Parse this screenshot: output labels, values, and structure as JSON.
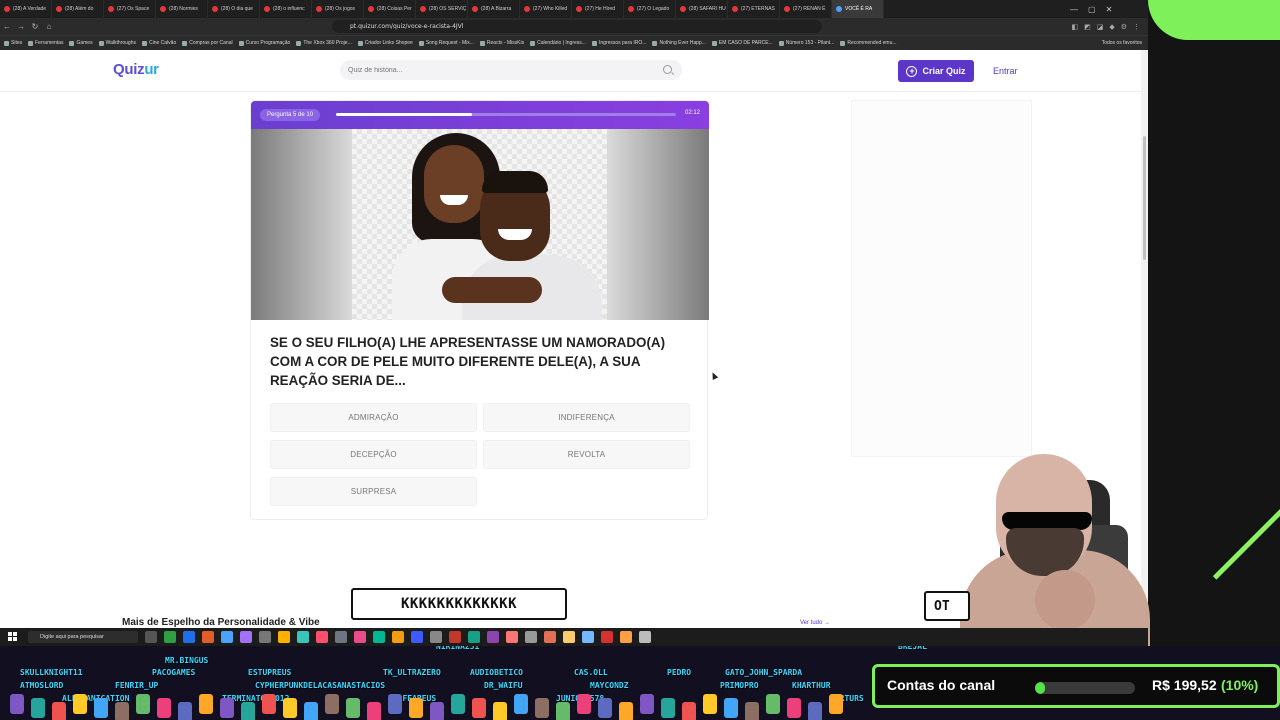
{
  "browser": {
    "tabs": [
      {
        "title": "(28) A Verdade",
        "active": false
      },
      {
        "title": "(28) Além do",
        "active": false
      },
      {
        "title": "(27) Os Space",
        "active": false
      },
      {
        "title": "(28) Normies",
        "active": false
      },
      {
        "title": "(28) O dia que",
        "active": false
      },
      {
        "title": "(28) o influenc",
        "active": false
      },
      {
        "title": "(28) Os jogos",
        "active": false
      },
      {
        "title": "(28) Coisas Per",
        "active": false
      },
      {
        "title": "(28) OS SERVIÇ",
        "active": false
      },
      {
        "title": "(28) A Bizarra",
        "active": false
      },
      {
        "title": "(27) Who Killed",
        "active": false
      },
      {
        "title": "(27) He Hired",
        "active": false
      },
      {
        "title": "(27) O Legado",
        "active": false
      },
      {
        "title": "(28) SAFARI HU",
        "active": false
      },
      {
        "title": "(27) ETERNAS",
        "active": false
      },
      {
        "title": "(27) RENAN É",
        "active": false
      },
      {
        "title": "VOCÊ É RA",
        "active": true
      }
    ],
    "url": "pt.quizur.com/quiz/voce-e-racista-4JVl",
    "bookmarks": [
      "Sites",
      "Ferramentas",
      "Games",
      "Walkthroughs",
      "Cine Calvão",
      "Compras por Canal",
      "Curso Programação",
      "The Xbox 360 Proje...",
      "Criador Links Shopee",
      "Song Request - Mix...",
      "Reacts - MissKis",
      "Calendário | Ingress...",
      "Ingressos para IRO...",
      "Nothing Ever Happ...",
      "EM CASO DE PARCE...",
      "Número 153 - Pilant...",
      "Recommended emu..."
    ],
    "bookmarks_right": "Todos os favoritos"
  },
  "site": {
    "logo_main": "Quiz",
    "logo_accent": "ur",
    "search_placeholder": "Quiz de história...",
    "create_label": "Criar Quiz",
    "login_label": "Entrar"
  },
  "quiz": {
    "progress_label": "Pergunta 5 de 10",
    "progress_fraction": 0.4,
    "timer": "02:12",
    "question": "SE O SEU FILHO(A) LHE APRESENTASSE UM NAMORADO(A) COM A COR DE PELE MUITO DIFERENTE DELE(A), A SUA REAÇÃO SERIA DE...",
    "answers": [
      "ADMIRAÇÃO",
      "INDIFERENÇA",
      "DECEPÇÃO",
      "REVOLTA",
      "SURPRESA"
    ]
  },
  "section": {
    "title": "Mais de Espelho da Personalidade & Vibe",
    "see_all": "Ver tudo →"
  },
  "overlay": {
    "chat_big": "KKKKKKKKKKKKK",
    "chat_small": "OT",
    "chat_names": [
      "SKULLKNIGHT11",
      "MR.BINGUS",
      "ESTUPREUS",
      "ATMOSLORD",
      "FENRIR_UP",
      "PACOGAMES",
      "ALLEFANICATION",
      "CYPHERPUNKDELACASANASTACIOS",
      "TERMINATOR2012",
      "TK_ULTRAZERO",
      "AUDIOBETICO",
      "NIRINA251",
      "DR_WAIFU",
      "TBAFFAREUS",
      "CAS.OLL",
      "MAYCONDZ",
      "JUNIOR2578",
      "PEDRO",
      "GATO_JOHN_SPARDA",
      "PRIMOPRO",
      "KHARTHUR",
      "MARTURS",
      "BREJAL"
    ],
    "goal_label": "Contas do canal",
    "goal_amount": "R$ 199,52",
    "goal_percent_text": "(10%)",
    "goal_fraction": 0.1,
    "taskbar_search": "Digite aqui para pesquisar"
  },
  "colors": {
    "brand": "#5b36c8",
    "accent_green": "#7ef05a",
    "chat_name": "#38d7ff"
  }
}
